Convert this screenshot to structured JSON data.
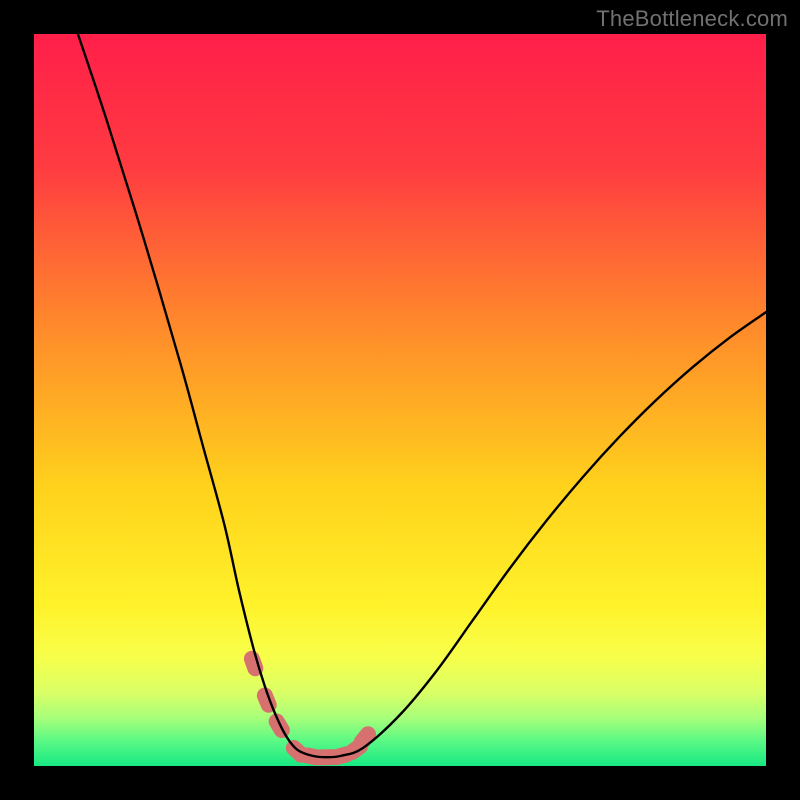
{
  "watermark": "TheBottleneck.com",
  "chart_data": {
    "type": "line",
    "title": "",
    "xlabel": "",
    "ylabel": "",
    "xlim": [
      0,
      100
    ],
    "ylim": [
      0,
      100
    ],
    "grid": false,
    "legend": false,
    "annotations": [],
    "series": [
      {
        "name": "curve",
        "color": "#000000",
        "x": [
          6,
          10,
          15,
          20,
          23,
          26,
          28,
          30,
          31.5,
          33,
          34.5,
          36,
          38,
          40,
          42,
          45,
          50,
          55,
          60,
          65,
          70,
          75,
          80,
          85,
          90,
          95,
          100
        ],
        "y": [
          100,
          88,
          72,
          55,
          44,
          33,
          24,
          16,
          11,
          7,
          4,
          2.2,
          1.4,
          1.2,
          1.4,
          2.5,
          7,
          13,
          20,
          27,
          33.5,
          39.5,
          45,
          50,
          54.5,
          58.5,
          62
        ]
      },
      {
        "name": "markers",
        "color": "#d6716f",
        "type": "scatter",
        "x": [
          30,
          31.8,
          33.5,
          36,
          38,
          40,
          42,
          44,
          45.2
        ],
        "y": [
          14,
          9,
          5.5,
          2,
          1.3,
          1.2,
          1.4,
          2.3,
          3.8
        ]
      }
    ],
    "background_gradient_stops": [
      {
        "offset": 0.0,
        "color": "#ff1f4a"
      },
      {
        "offset": 0.18,
        "color": "#ff3b41"
      },
      {
        "offset": 0.4,
        "color": "#ff8a2b"
      },
      {
        "offset": 0.62,
        "color": "#ffd21c"
      },
      {
        "offset": 0.78,
        "color": "#fff22a"
      },
      {
        "offset": 0.85,
        "color": "#f8ff4a"
      },
      {
        "offset": 0.9,
        "color": "#d9ff66"
      },
      {
        "offset": 0.935,
        "color": "#a6ff7a"
      },
      {
        "offset": 0.965,
        "color": "#5cf985"
      },
      {
        "offset": 1.0,
        "color": "#17e884"
      }
    ]
  }
}
